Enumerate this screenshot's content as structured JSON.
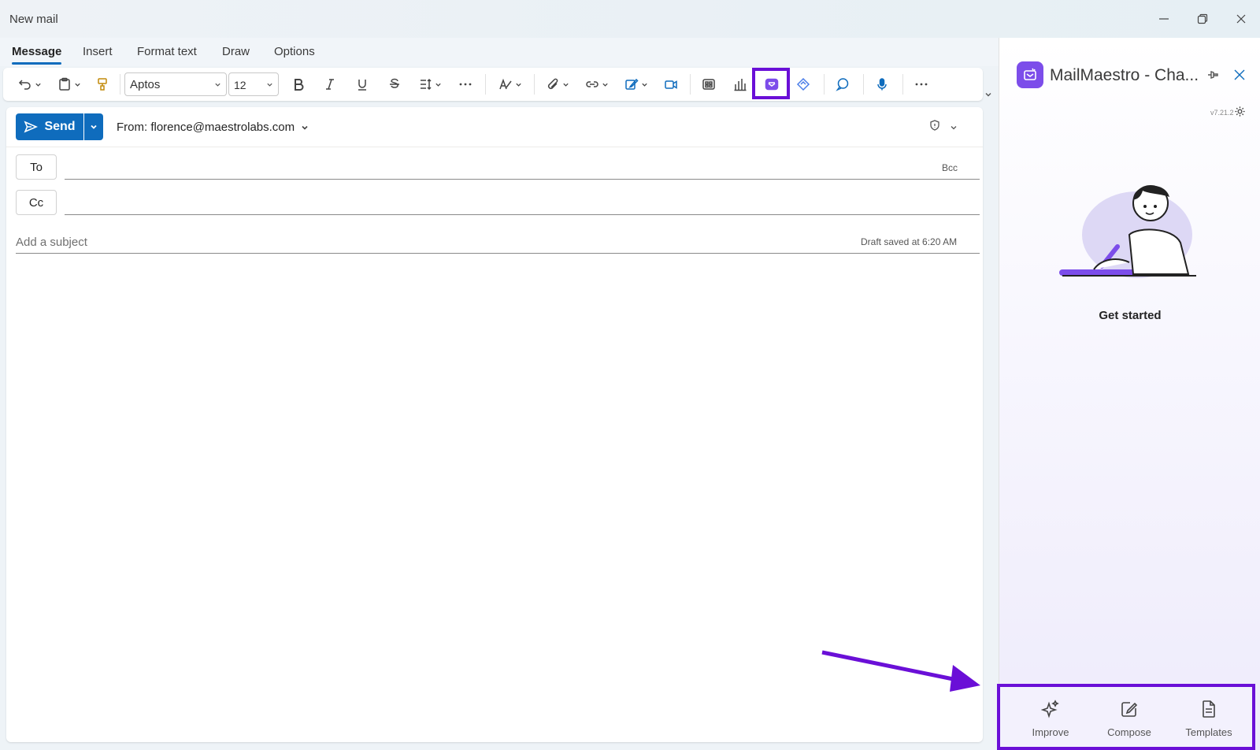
{
  "window": {
    "title": "New mail"
  },
  "tabs": [
    {
      "label": "Message"
    },
    {
      "label": "Insert"
    },
    {
      "label": "Format text"
    },
    {
      "label": "Draw"
    },
    {
      "label": "Options"
    }
  ],
  "toolbar": {
    "font": "Aptos",
    "size": "12"
  },
  "compose": {
    "send_label": "Send",
    "from": "From: florence@maestrolabs.com",
    "to_label": "To",
    "cc_label": "Cc",
    "bcc_label": "Bcc",
    "subject_placeholder": "Add a subject",
    "draft_status": "Draft saved at 6:20 AM"
  },
  "sidepanel": {
    "title": "MailMaestro - Cha...",
    "version": "v7.21.2",
    "heading": "Get started",
    "actions": [
      {
        "label": "Improve",
        "icon": "sparkle-icon"
      },
      {
        "label": "Compose",
        "icon": "edit-icon"
      },
      {
        "label": "Templates",
        "icon": "document-icon"
      }
    ]
  },
  "colors": {
    "accent": "#0f6cbd",
    "highlight": "#6a0fd7",
    "brand": "#7c4dea"
  }
}
